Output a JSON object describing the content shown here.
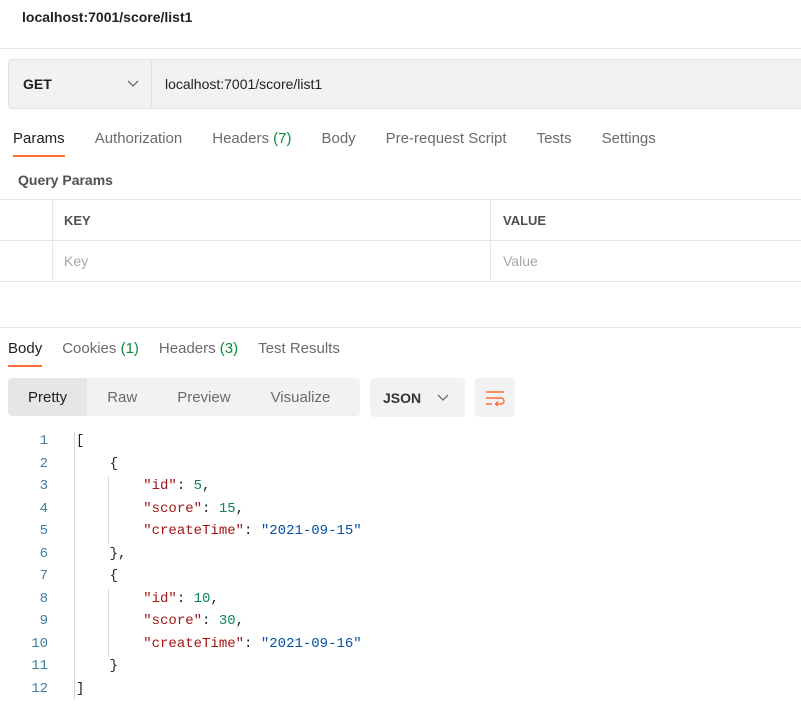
{
  "title": "localhost:7001/score/list1",
  "request": {
    "method": "GET",
    "url": "localhost:7001/score/list1"
  },
  "request_tabs": [
    {
      "label": "Params",
      "count": null,
      "active": true
    },
    {
      "label": "Authorization",
      "count": null
    },
    {
      "label": "Headers",
      "count": "(7)"
    },
    {
      "label": "Body",
      "count": null
    },
    {
      "label": "Pre-request Script",
      "count": null
    },
    {
      "label": "Tests",
      "count": null
    },
    {
      "label": "Settings",
      "count": null
    }
  ],
  "query_params": {
    "title": "Query Params",
    "key_header": "KEY",
    "value_header": "VALUE",
    "key_placeholder": "Key",
    "value_placeholder": "Value"
  },
  "response_tabs": [
    {
      "label": "Body",
      "count": null,
      "active": true
    },
    {
      "label": "Cookies",
      "count": "(1)"
    },
    {
      "label": "Headers",
      "count": "(3)"
    },
    {
      "label": "Test Results",
      "count": null
    }
  ],
  "views": [
    "Pretty",
    "Raw",
    "Preview",
    "Visualize"
  ],
  "active_view": "Pretty",
  "format": "JSON",
  "icons": {
    "method_dropdown": "chevron-down-icon",
    "format_dropdown": "chevron-down-icon",
    "wrap": "wrap-lines-icon"
  },
  "colors": {
    "accent": "#ff6c37",
    "key": "#a31515",
    "number": "#098658",
    "string": "#0451a5",
    "count": "#0b8a3a"
  },
  "code_lines": [
    [
      [
        "p",
        "["
      ]
    ],
    [
      [
        "p",
        "    {"
      ]
    ],
    [
      [
        "p",
        "        "
      ],
      [
        "k",
        "\"id\""
      ],
      [
        "p",
        ": "
      ],
      [
        "n",
        "5"
      ],
      [
        "p",
        ","
      ]
    ],
    [
      [
        "p",
        "        "
      ],
      [
        "k",
        "\"score\""
      ],
      [
        "p",
        ": "
      ],
      [
        "n",
        "15"
      ],
      [
        "p",
        ","
      ]
    ],
    [
      [
        "p",
        "        "
      ],
      [
        "k",
        "\"createTime\""
      ],
      [
        "p",
        ": "
      ],
      [
        "s",
        "\"2021-09-15\""
      ]
    ],
    [
      [
        "p",
        "    },"
      ]
    ],
    [
      [
        "p",
        "    {"
      ]
    ],
    [
      [
        "p",
        "        "
      ],
      [
        "k",
        "\"id\""
      ],
      [
        "p",
        ": "
      ],
      [
        "n",
        "10"
      ],
      [
        "p",
        ","
      ]
    ],
    [
      [
        "p",
        "        "
      ],
      [
        "k",
        "\"score\""
      ],
      [
        "p",
        ": "
      ],
      [
        "n",
        "30"
      ],
      [
        "p",
        ","
      ]
    ],
    [
      [
        "p",
        "        "
      ],
      [
        "k",
        "\"createTime\""
      ],
      [
        "p",
        ": "
      ],
      [
        "s",
        "\"2021-09-16\""
      ]
    ],
    [
      [
        "p",
        "    }"
      ]
    ],
    [
      [
        "p",
        "]"
      ]
    ]
  ]
}
